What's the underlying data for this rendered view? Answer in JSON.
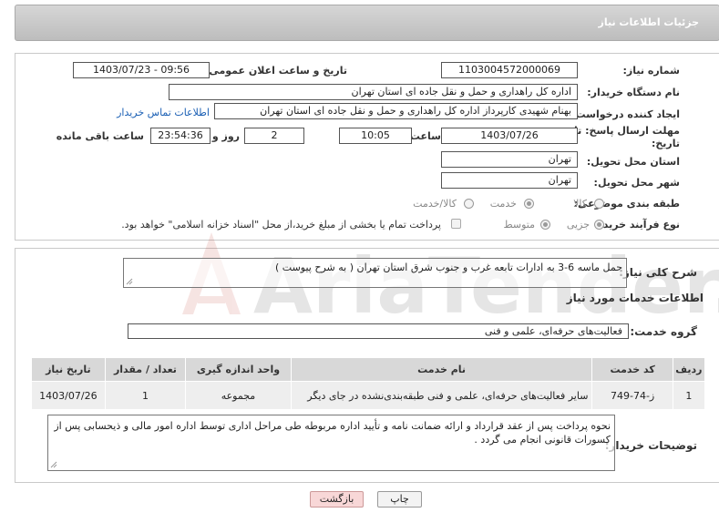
{
  "header": {
    "title": "جزئیات اطلاعات نیاز"
  },
  "form": {
    "need_number_label": "شماره نیاز:",
    "need_number": "1103004572000069",
    "announce_label": "تاریخ و ساعت اعلان عمومی:",
    "announce_value": "1403/07/23 - 09:56",
    "buyer_org_label": "نام دستگاه خریدار:",
    "buyer_org": "اداره کل راهداری و حمل و نقل جاده ای استان تهران",
    "creator_label": "ایجاد کننده درخواست:",
    "creator": "بهنام شهیدی کارپرداز اداره کل راهداری و حمل و نقل جاده ای استان تهران",
    "contact_link": "اطلاعات تماس خریدار",
    "deadline_label": "مهلت ارسال پاسخ: تا تاریخ:",
    "deadline_date": "1403/07/26",
    "time_label": "ساعت",
    "deadline_time": "10:05",
    "days_value": "2",
    "days_label": "روز و",
    "remaining_value": "23:54:36",
    "remaining_label": "ساعت باقی مانده",
    "province_label": "استان محل تحویل:",
    "province": "تهران",
    "city_label": "شهر محل تحویل:",
    "city": "تهران",
    "category_label": "طبقه بندی موضوعی:",
    "category_options": [
      "کالا",
      "خدمت",
      "کالا/خدمت"
    ],
    "category_selected": "خدمت",
    "process_label": "نوع فرآیند خرید :",
    "process_options": [
      "جزیی",
      "متوسط"
    ],
    "process_selected": "جزیی",
    "payment_note": "پرداخت تمام یا بخشی از مبلغ خرید،از محل \"اسناد خزانه اسلامی\" خواهد بود."
  },
  "summary": {
    "label": "شرح کلی نیاز:",
    "text": "حمل ماسه 6-3 به ادارات تابعه غرب و جنوب شرق استان تهران ( به شرح پیوست )"
  },
  "services_section": {
    "title": "اطلاعات خدمات مورد نیاز",
    "group_label": "گروه خدمت:",
    "group_value": "فعالیت‌های حرفه‌ای، علمی و فنی"
  },
  "table": {
    "headers": [
      "ردیف",
      "کد خدمت",
      "نام خدمت",
      "واحد اندازه گیری",
      "تعداد / مقدار",
      "تاریخ نیاز"
    ],
    "rows": [
      {
        "index": "1",
        "code": "ز-74-749",
        "name": "سایر فعالیت‌های حرفه‌ای، علمی و فنی طبقه‌بندی‌نشده در جای دیگر",
        "unit": "مجموعه",
        "qty": "1",
        "date": "1403/07/26"
      }
    ]
  },
  "buyer_notes": {
    "label": "توضیحات خریدار:",
    "text": "نحوه پرداخت پس از عقد قرارداد و ارائه ضمانت نامه و تأیید اداره مربوطه طی مراحل اداری توسط اداره امور مالی و ذیحسابی پس از کسورات قانونی انجام می گردد ."
  },
  "buttons": {
    "print": "چاپ",
    "back": "بازگشت"
  },
  "watermark": {
    "text": "AriaTender.neT"
  },
  "colors": {
    "header_bg": "#c4c4c4",
    "link": "#1a5fb4",
    "back_button_bg": "#f8d7d7",
    "table_header_bg": "#d8d8d8",
    "table_row_bg": "#eeeeee"
  }
}
